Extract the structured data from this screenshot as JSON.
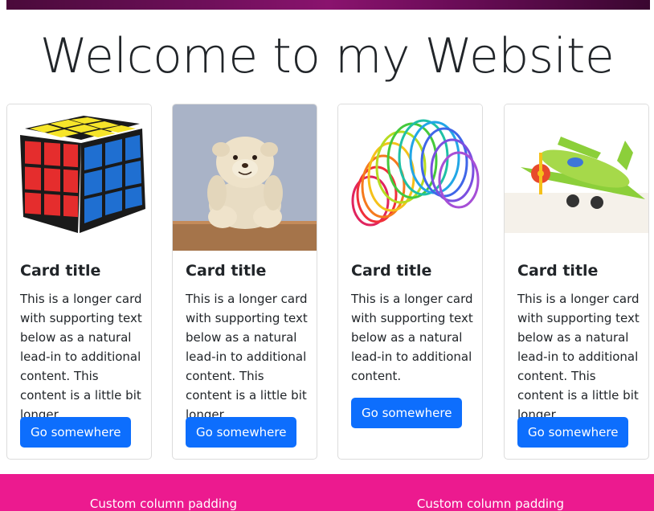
{
  "header": {
    "title": "Welcome to my Website"
  },
  "cards": [
    {
      "image": "rubiks-cube",
      "title": "Card title",
      "text": "This is a longer card with supporting text below as a natural lead-in to additional content. This content is a little bit longer.",
      "button": "Go somewhere"
    },
    {
      "image": "teddy-bear",
      "title": "Card title",
      "text": "This is a longer card with supporting text below as a natural lead-in to additional content. This content is a little bit longer.",
      "button": "Go somewhere"
    },
    {
      "image": "rainbow-slinky",
      "title": "Card title",
      "text": "This is a longer card with supporting text below as a natural lead-in to additional content.",
      "button": "Go somewhere"
    },
    {
      "image": "toy-airplane",
      "title": "Card title",
      "text": "This is a longer card with supporting text below as a natural lead-in to additional content. This content is a little bit longer.",
      "button": "Go somewhere"
    }
  ],
  "footer": {
    "columns": [
      "Custom column padding",
      "Custom column padding"
    ]
  },
  "colors": {
    "accent": "#0d6efd",
    "footer": "#ec1a8f"
  }
}
